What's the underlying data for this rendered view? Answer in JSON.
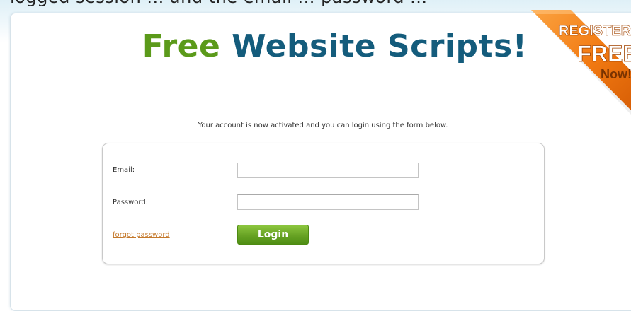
{
  "header": {
    "top_caption": "logged session ... and the email ... password ...",
    "title_part1": "Free",
    "title_part2": "Website Scripts!"
  },
  "promo": {
    "line1": "REGISTER",
    "line2": "FREE",
    "line3": "Now!"
  },
  "main": {
    "activation_message": "Your account is now activated and you can login using the form below."
  },
  "login_form": {
    "email_label": "Email:",
    "email_value": "",
    "password_label": "Password:",
    "password_value": "",
    "forgot_link": "forgot password",
    "login_button": "Login"
  },
  "colors": {
    "brand_green": "#5b9a1a",
    "brand_blue": "#145c7c",
    "ribbon_orange": "#f27a12",
    "link_orange": "#c4782a"
  }
}
